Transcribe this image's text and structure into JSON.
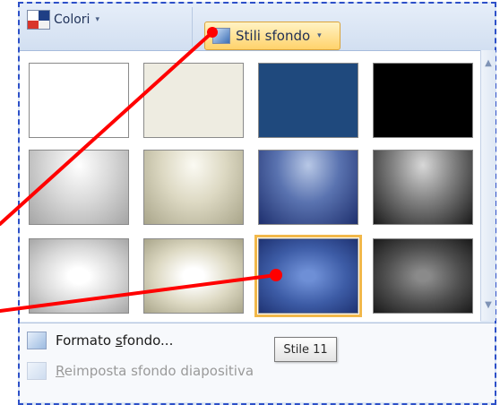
{
  "ribbon": {
    "colori_label": "Colori",
    "stili_label": "Stili sfondo",
    "dropdown_glyph": "▾"
  },
  "gallery": {
    "tooltip": "Stile 11",
    "selected_index": 10,
    "rows": 3,
    "cols": 4,
    "scroll_up_glyph": "▲",
    "scroll_down_glyph": "▼"
  },
  "menu": {
    "item1_prefix": "Formato ",
    "item1_underlined": "s",
    "item1_suffix": "fondo...",
    "item2_underlined": "R",
    "item2_suffix": "eimposta sfondo diapositiva"
  },
  "colors": {
    "frame_border": "#2d50c8",
    "highlight": "#f2b84a",
    "arrow": "#ff0000"
  }
}
